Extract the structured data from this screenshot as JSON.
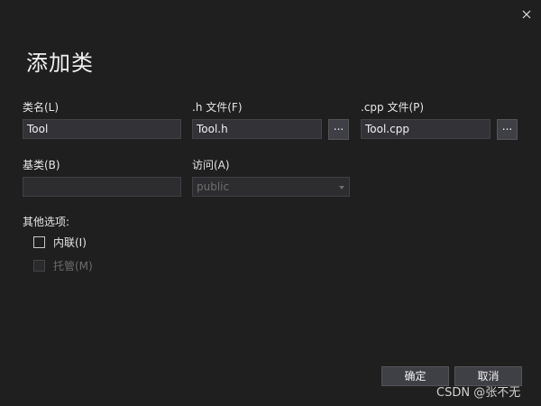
{
  "dialog": {
    "title": "添加类",
    "close_icon": "close-icon"
  },
  "fields": {
    "class_name": {
      "label": "类名(L)",
      "value": "Tool"
    },
    "h_file": {
      "label": ".h 文件(F)",
      "value": "Tool.h",
      "browse_label": "..."
    },
    "cpp_file": {
      "label": ".cpp 文件(P)",
      "value": "Tool.cpp",
      "browse_label": "..."
    },
    "base_class": {
      "label": "基类(B)",
      "value": ""
    },
    "access": {
      "label": "访问(A)",
      "selected": "public"
    }
  },
  "options": {
    "heading": "其他选项:",
    "inline": {
      "label": "内联(I)",
      "checked": false,
      "enabled": true
    },
    "managed": {
      "label": "托管(M)",
      "checked": false,
      "enabled": false
    }
  },
  "buttons": {
    "ok": "确定",
    "cancel": "取消"
  },
  "watermark": "CSDN @张不无",
  "colors": {
    "background": "#1f1f1f",
    "input_background": "#333337",
    "button_background": "#3f3f46",
    "disabled_text": "#6d6d6d"
  }
}
